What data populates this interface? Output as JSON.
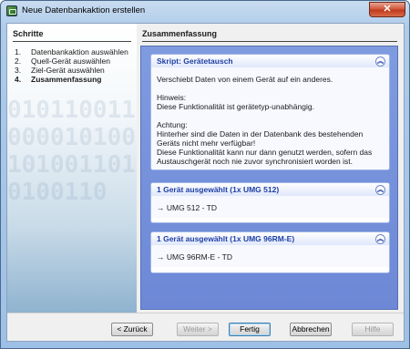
{
  "window": {
    "title": "Neue Datenbankaktion erstellen",
    "close_glyph": "✕"
  },
  "steps": {
    "heading": "Schritte",
    "items": [
      {
        "num": "1.",
        "label": "Datenbankaktion auswählen"
      },
      {
        "num": "2.",
        "label": "Quell-Gerät auswählen"
      },
      {
        "num": "3.",
        "label": "Ziel-Gerät auswählen"
      },
      {
        "num": "4.",
        "label": "Zusammenfassung"
      }
    ],
    "active_index": 3,
    "background_pattern": "0101100110000101001010011010100110"
  },
  "summary": {
    "heading": "Zusammenfassung",
    "cards": [
      {
        "title": "Skript: Gerätetausch",
        "icon": "chevron-up-icon",
        "paragraphs": [
          "Verschiebt Daten von einem Gerät auf ein anderes.",
          "Hinweis:\nDiese Funktionalität ist gerätetyp-unabhängig.",
          "Achtung:\nHinterher sind die Daten in der Datenbank des bestehenden Geräts nicht mehr verfügbar!\nDiese Funktionalität kann nur dann genutzt werden, sofern das Austauschgerät noch nie zuvor synchronisiert worden ist."
        ]
      },
      {
        "title": "1 Gerät ausgewählt (1x UMG 512)",
        "icon": "chevron-up-icon",
        "paragraphs": [
          "→ UMG 512 - TD"
        ]
      },
      {
        "title": "1 Gerät ausgewählt (1x UMG 96RM-E)",
        "icon": "chevron-up-icon",
        "paragraphs": [
          "→ UMG 96RM-E - TD"
        ]
      }
    ]
  },
  "footer": {
    "back": "< Zurück",
    "next": "Weiter >",
    "finish": "Fertig",
    "cancel": "Abbrechen",
    "help": "Hilfe"
  },
  "colors": {
    "card_title": "#1f3fa6",
    "cards_background": "#7f9be0",
    "close_button": "#c03a1e"
  }
}
